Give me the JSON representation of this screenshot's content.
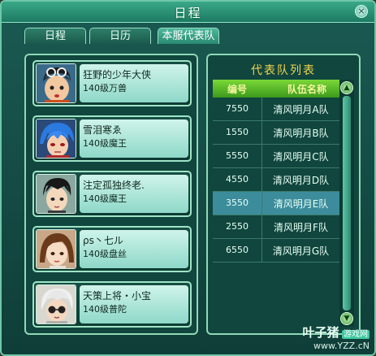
{
  "window": {
    "title": "日程",
    "close_icon": "×"
  },
  "tabs": [
    {
      "label": "日程"
    },
    {
      "label": "日历"
    },
    {
      "label": "本服代表队",
      "active": true
    }
  ],
  "members": [
    {
      "name": "狂野的少年大侠",
      "level": "140级万兽",
      "avatar": "avatar-boy-glasses"
    },
    {
      "name": "雪泪寒ゑ",
      "level": "140级魔王",
      "avatar": "avatar-blue-hair"
    },
    {
      "name": "注定孤独终老.",
      "level": "140级魔王",
      "avatar": "avatar-dark-hair"
    },
    {
      "name": "ρs丶七ル",
      "level": "140级盘丝",
      "avatar": "avatar-brown-hair"
    },
    {
      "name": "天策上将・小宝",
      "level": "140级普陀",
      "avatar": "avatar-silver-hair"
    }
  ],
  "team_list": {
    "title": "代表队列表",
    "headers": [
      "编号",
      "队伍名称"
    ],
    "rows": [
      {
        "code": "7550",
        "team": "清风明月A队",
        "selected": false
      },
      {
        "code": "1550",
        "team": "清风明月B队",
        "selected": false
      },
      {
        "code": "5550",
        "team": "清风明月C队",
        "selected": false
      },
      {
        "code": "4550",
        "team": "清风明月D队",
        "selected": false
      },
      {
        "code": "3550",
        "team": "清风明月E队",
        "selected": true
      },
      {
        "code": "2550",
        "team": "清风明月F队",
        "selected": false
      },
      {
        "code": "6550",
        "team": "清风明月G队",
        "selected": false
      }
    ]
  },
  "scroll": {
    "up_icon": "▲",
    "down_icon": "▼"
  },
  "watermark": {
    "brand": "叶子猪",
    "badge": "游戏网",
    "url": "www.YZZ.cN"
  },
  "colors": {
    "accent": "#f4d44a",
    "header_green": "#5cb82a",
    "selected_row": "#3c8c9c"
  }
}
